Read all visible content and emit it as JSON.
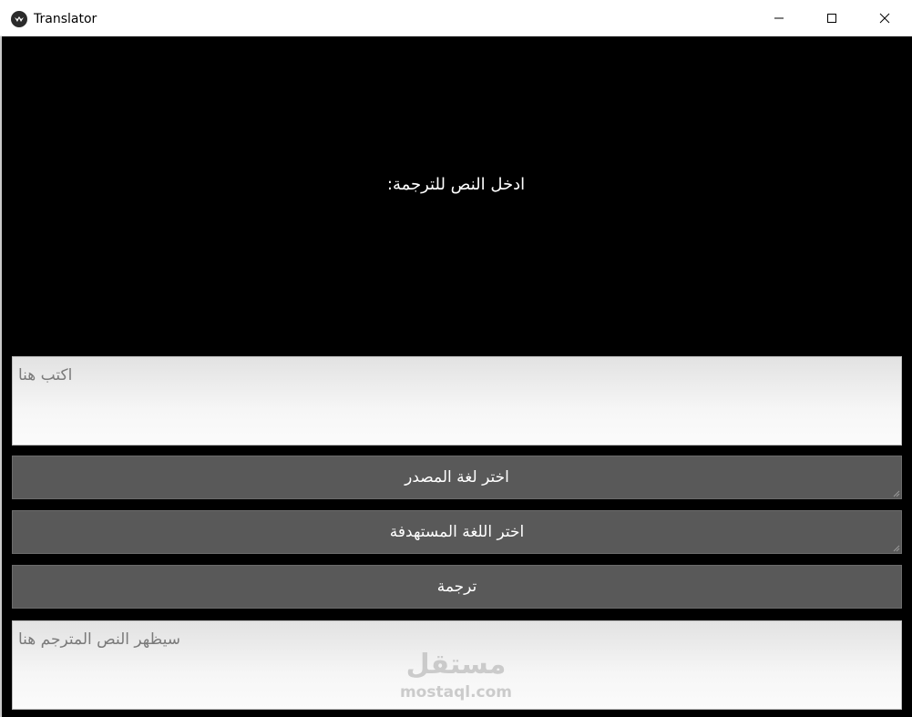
{
  "window": {
    "title": "Translator",
    "icon": "kivy-logo-icon"
  },
  "prompt": {
    "text": "ادخل النص للترجمة:"
  },
  "input": {
    "placeholder": "اكتب هنا"
  },
  "buttons": {
    "source_language": "اختر لغة المصدر",
    "target_language": "اختر اللغة المستهدفة",
    "translate": "ترجمة"
  },
  "output": {
    "placeholder": "سيظهر النص المترجم هنا"
  },
  "watermark": {
    "arabic": "مستقل",
    "latin": "mostaql.com"
  },
  "colors": {
    "background": "#000000",
    "button": "#595959",
    "field": "#f2f2f2",
    "text": "#ffffff"
  }
}
